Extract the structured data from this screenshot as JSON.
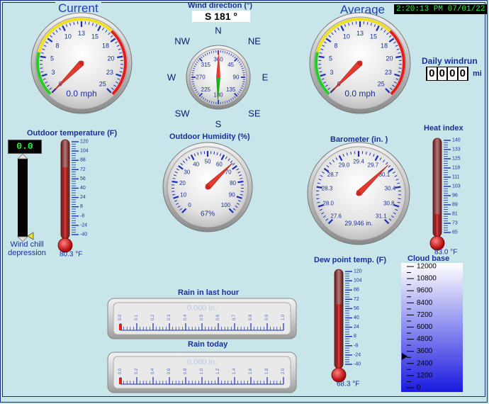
{
  "headers": {
    "current": "Current",
    "average": "Average"
  },
  "clock": "2:20:13 PM 07/01/22",
  "wind_direction": {
    "title": "Wind direction (°)",
    "value": "S  181 °",
    "compass": [
      "N",
      "NE",
      "E",
      "SE",
      "S",
      "SW",
      "W",
      "NW"
    ],
    "dial_ticks": [
      "360",
      "45",
      "90",
      "135",
      "180",
      "225",
      "270",
      "315"
    ],
    "bearing": 181
  },
  "wind_current": {
    "readout": "0.0 mph",
    "ticks": [
      "0",
      "3",
      "5",
      "8",
      "10",
      "13",
      "15",
      "18",
      "20",
      "23",
      "25"
    ],
    "value": 0.0
  },
  "wind_average": {
    "readout": "0.0 mph",
    "ticks": [
      "0",
      "3",
      "5",
      "8",
      "10",
      "13",
      "15",
      "18",
      "20",
      "23",
      "25"
    ],
    "value": 0.0
  },
  "windrun": {
    "title": "Daily windrun",
    "digits": [
      "0",
      "0",
      "0",
      "0"
    ],
    "unit": "mi"
  },
  "outdoor_temp": {
    "title": "Outdoor temperature (F)",
    "readout": "80.3 °F",
    "scale": [
      "120",
      "104",
      "88",
      "72",
      "56",
      "40",
      "24",
      "8",
      "-8",
      "-24",
      "-40"
    ],
    "value": 80.3
  },
  "wind_chill": {
    "value": "0.0",
    "label": "Wind chill depression"
  },
  "humidity": {
    "title": "Outdoor Humidity (%)",
    "readout": "67%",
    "ticks": [
      "0",
      "10",
      "20",
      "30",
      "40",
      "50",
      "60",
      "70",
      "80",
      "90",
      "100"
    ],
    "value": 67
  },
  "barometer": {
    "title": "Barometer (in. )",
    "readout": "29.946 in.",
    "ticks": [
      "27.6",
      "28.0",
      "28.3",
      "28.7",
      "29.0",
      "29.4",
      "29.7",
      "30.1",
      "30.4",
      "30.8",
      "31.1"
    ],
    "value": 29.946
  },
  "heat_index": {
    "title": "Heat index",
    "readout": "83.0 °F",
    "scale": [
      "140",
      "133",
      "125",
      "118",
      "111",
      "103",
      "96",
      "89",
      "81",
      "73",
      "65"
    ],
    "value": 83.0
  },
  "dew_point": {
    "title": "Dew point temp. (F)",
    "readout": "68.3 °F",
    "scale": [
      "120",
      "104",
      "88",
      "72",
      "56",
      "40",
      "24",
      "8",
      "-8",
      "-24",
      "-40"
    ],
    "value": 68.3
  },
  "cloud_base": {
    "title": "Cloud base",
    "scale": [
      "12000",
      "10800",
      "9600",
      "8400",
      "7200",
      "6000",
      "4800",
      "3600",
      "2400",
      "1200",
      "0"
    ],
    "value": 3100
  },
  "rain_hour": {
    "title": "Rain in last hour",
    "readout": "0.000 in.",
    "ticks": [
      "0.0",
      "0.1",
      "0.2",
      "0.3",
      "0.4",
      "0.5",
      "0.6",
      "0.7",
      "0.8",
      "0.9",
      "1.0"
    ],
    "value": 0.0
  },
  "rain_today": {
    "title": "Rain today",
    "readout": "0.000 in.",
    "ticks": [
      "0.0",
      "0.2",
      "0.4",
      "0.6",
      "0.8",
      "1.0",
      "1.2",
      "1.4",
      "1.6",
      "1.8",
      "2.0"
    ],
    "value": 0.0
  }
}
